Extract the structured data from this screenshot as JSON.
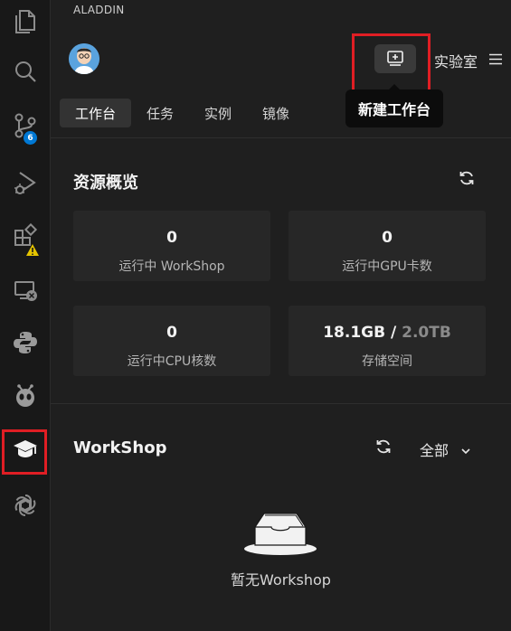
{
  "app": {
    "title": "ALADDIN"
  },
  "activity_bar": {
    "items": [
      {
        "icon": "files-icon"
      },
      {
        "icon": "search-icon"
      },
      {
        "icon": "source-control-icon",
        "badge": "6"
      },
      {
        "icon": "run-debug-icon"
      },
      {
        "icon": "extensions-icon",
        "badge": "warning"
      },
      {
        "icon": "remote-explorer-icon"
      },
      {
        "icon": "python-icon"
      },
      {
        "icon": "alien-icon"
      },
      {
        "icon": "graduation-cap-icon",
        "active": true
      },
      {
        "icon": "openai-icon"
      }
    ]
  },
  "header": {
    "new_workspace_tooltip": "新建工作台",
    "lab_label": "实验室"
  },
  "tabs": [
    {
      "label": "工作台",
      "active": true
    },
    {
      "label": "任务"
    },
    {
      "label": "实例"
    },
    {
      "label": "镜像"
    }
  ],
  "overview": {
    "title": "资源概览",
    "cards": [
      {
        "value": "0",
        "label": "运行中 WorkShop"
      },
      {
        "value": "0",
        "label": "运行中GPU卡数"
      },
      {
        "value": "0",
        "label": "运行中CPU核数"
      },
      {
        "value": "18.1GB",
        "separator": " / ",
        "total": "2.0TB",
        "label": "存储空间"
      }
    ]
  },
  "workshop": {
    "title": "WorkShop",
    "filter": "全部",
    "empty_text": "暂无Workshop"
  },
  "colors": {
    "highlight": "#e01e24",
    "badge": "#0078d4",
    "warning": "#e5c400"
  }
}
